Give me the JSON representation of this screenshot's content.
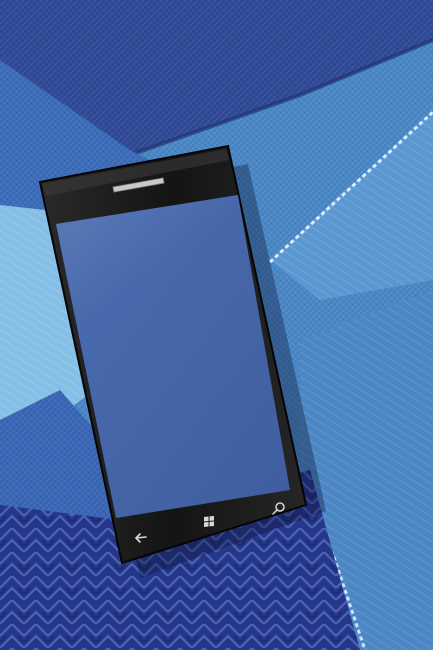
{
  "scene": {
    "subject": "smartphone-on-fabric",
    "colors": {
      "fabric_navy": "#2c3f86",
      "fabric_royal": "#3b63b3",
      "fabric_sky": "#4d8fcf",
      "fabric_pale": "#86bfe6",
      "phone_body": "#151515",
      "screen": "#4565a8"
    }
  },
  "phone": {
    "buttons": [
      {
        "name": "back-button",
        "icon": "back-arrow-icon"
      },
      {
        "name": "home-button",
        "icon": "windows-logo-icon"
      },
      {
        "name": "search-button",
        "icon": "search-icon"
      }
    ]
  }
}
